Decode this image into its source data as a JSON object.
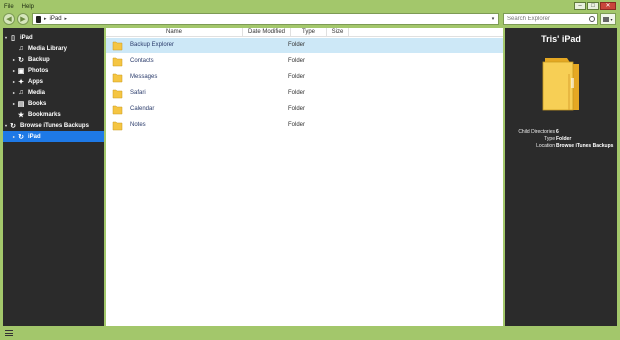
{
  "menu": {
    "file": "File",
    "help": "Help"
  },
  "window_controls": {
    "minimize": "–",
    "maximize": "□",
    "close": "✕"
  },
  "toolbar": {
    "back": "◀",
    "forward": "▶",
    "path": [
      "iPad"
    ],
    "path_arrow": "▸",
    "path_dropdown": "▾",
    "search_placeholder": "Search Explorer"
  },
  "sidebar": {
    "items": [
      {
        "label": "iPad",
        "icon": "ipad-icon",
        "glyph": "▯",
        "expander": "▾"
      },
      {
        "label": "Media Library",
        "icon": "music-icon",
        "glyph": "♫",
        "expander": ""
      },
      {
        "label": "Backup",
        "icon": "backup-icon",
        "glyph": "↻",
        "expander": "▸"
      },
      {
        "label": "Photos",
        "icon": "photos-icon",
        "glyph": "▣",
        "expander": "▸"
      },
      {
        "label": "Apps",
        "icon": "apps-icon",
        "glyph": "✦",
        "expander": "▸"
      },
      {
        "label": "Media",
        "icon": "media-icon",
        "glyph": "♫",
        "expander": "▸"
      },
      {
        "label": "Books",
        "icon": "books-icon",
        "glyph": "▤",
        "expander": "▸"
      },
      {
        "label": "Bookmarks",
        "icon": "bookmarks-icon",
        "glyph": "★",
        "expander": ""
      },
      {
        "label": "Browse iTunes Backups",
        "icon": "itunes-backups-icon",
        "glyph": "↻",
        "expander": "▾"
      },
      {
        "label": "iPad",
        "icon": "backup-ipad-icon",
        "glyph": "↻",
        "expander": "▸"
      }
    ]
  },
  "list": {
    "columns": [
      "Name",
      "Date Modified",
      "Type",
      "Size"
    ],
    "rows": [
      {
        "name": "Backup Explorer",
        "type": "Folder"
      },
      {
        "name": "Contacts",
        "type": "Folder"
      },
      {
        "name": "Messages",
        "type": "Folder"
      },
      {
        "name": "Safari",
        "type": "Folder"
      },
      {
        "name": "Calendar",
        "type": "Folder"
      },
      {
        "name": "Notes",
        "type": "Folder"
      }
    ]
  },
  "info": {
    "title": "Tris' iPad",
    "props": [
      {
        "key": "Child Directories",
        "value": "6"
      },
      {
        "key": "Type",
        "value": "Folder"
      },
      {
        "key": "Location",
        "value": "Browse iTunes Backups"
      }
    ]
  },
  "colors": {
    "chrome": "#a3c76b",
    "panel": "#2b2b2b",
    "selection": "#1e79e6",
    "row_selection": "#cde8f7",
    "folder": "#f5c542"
  }
}
